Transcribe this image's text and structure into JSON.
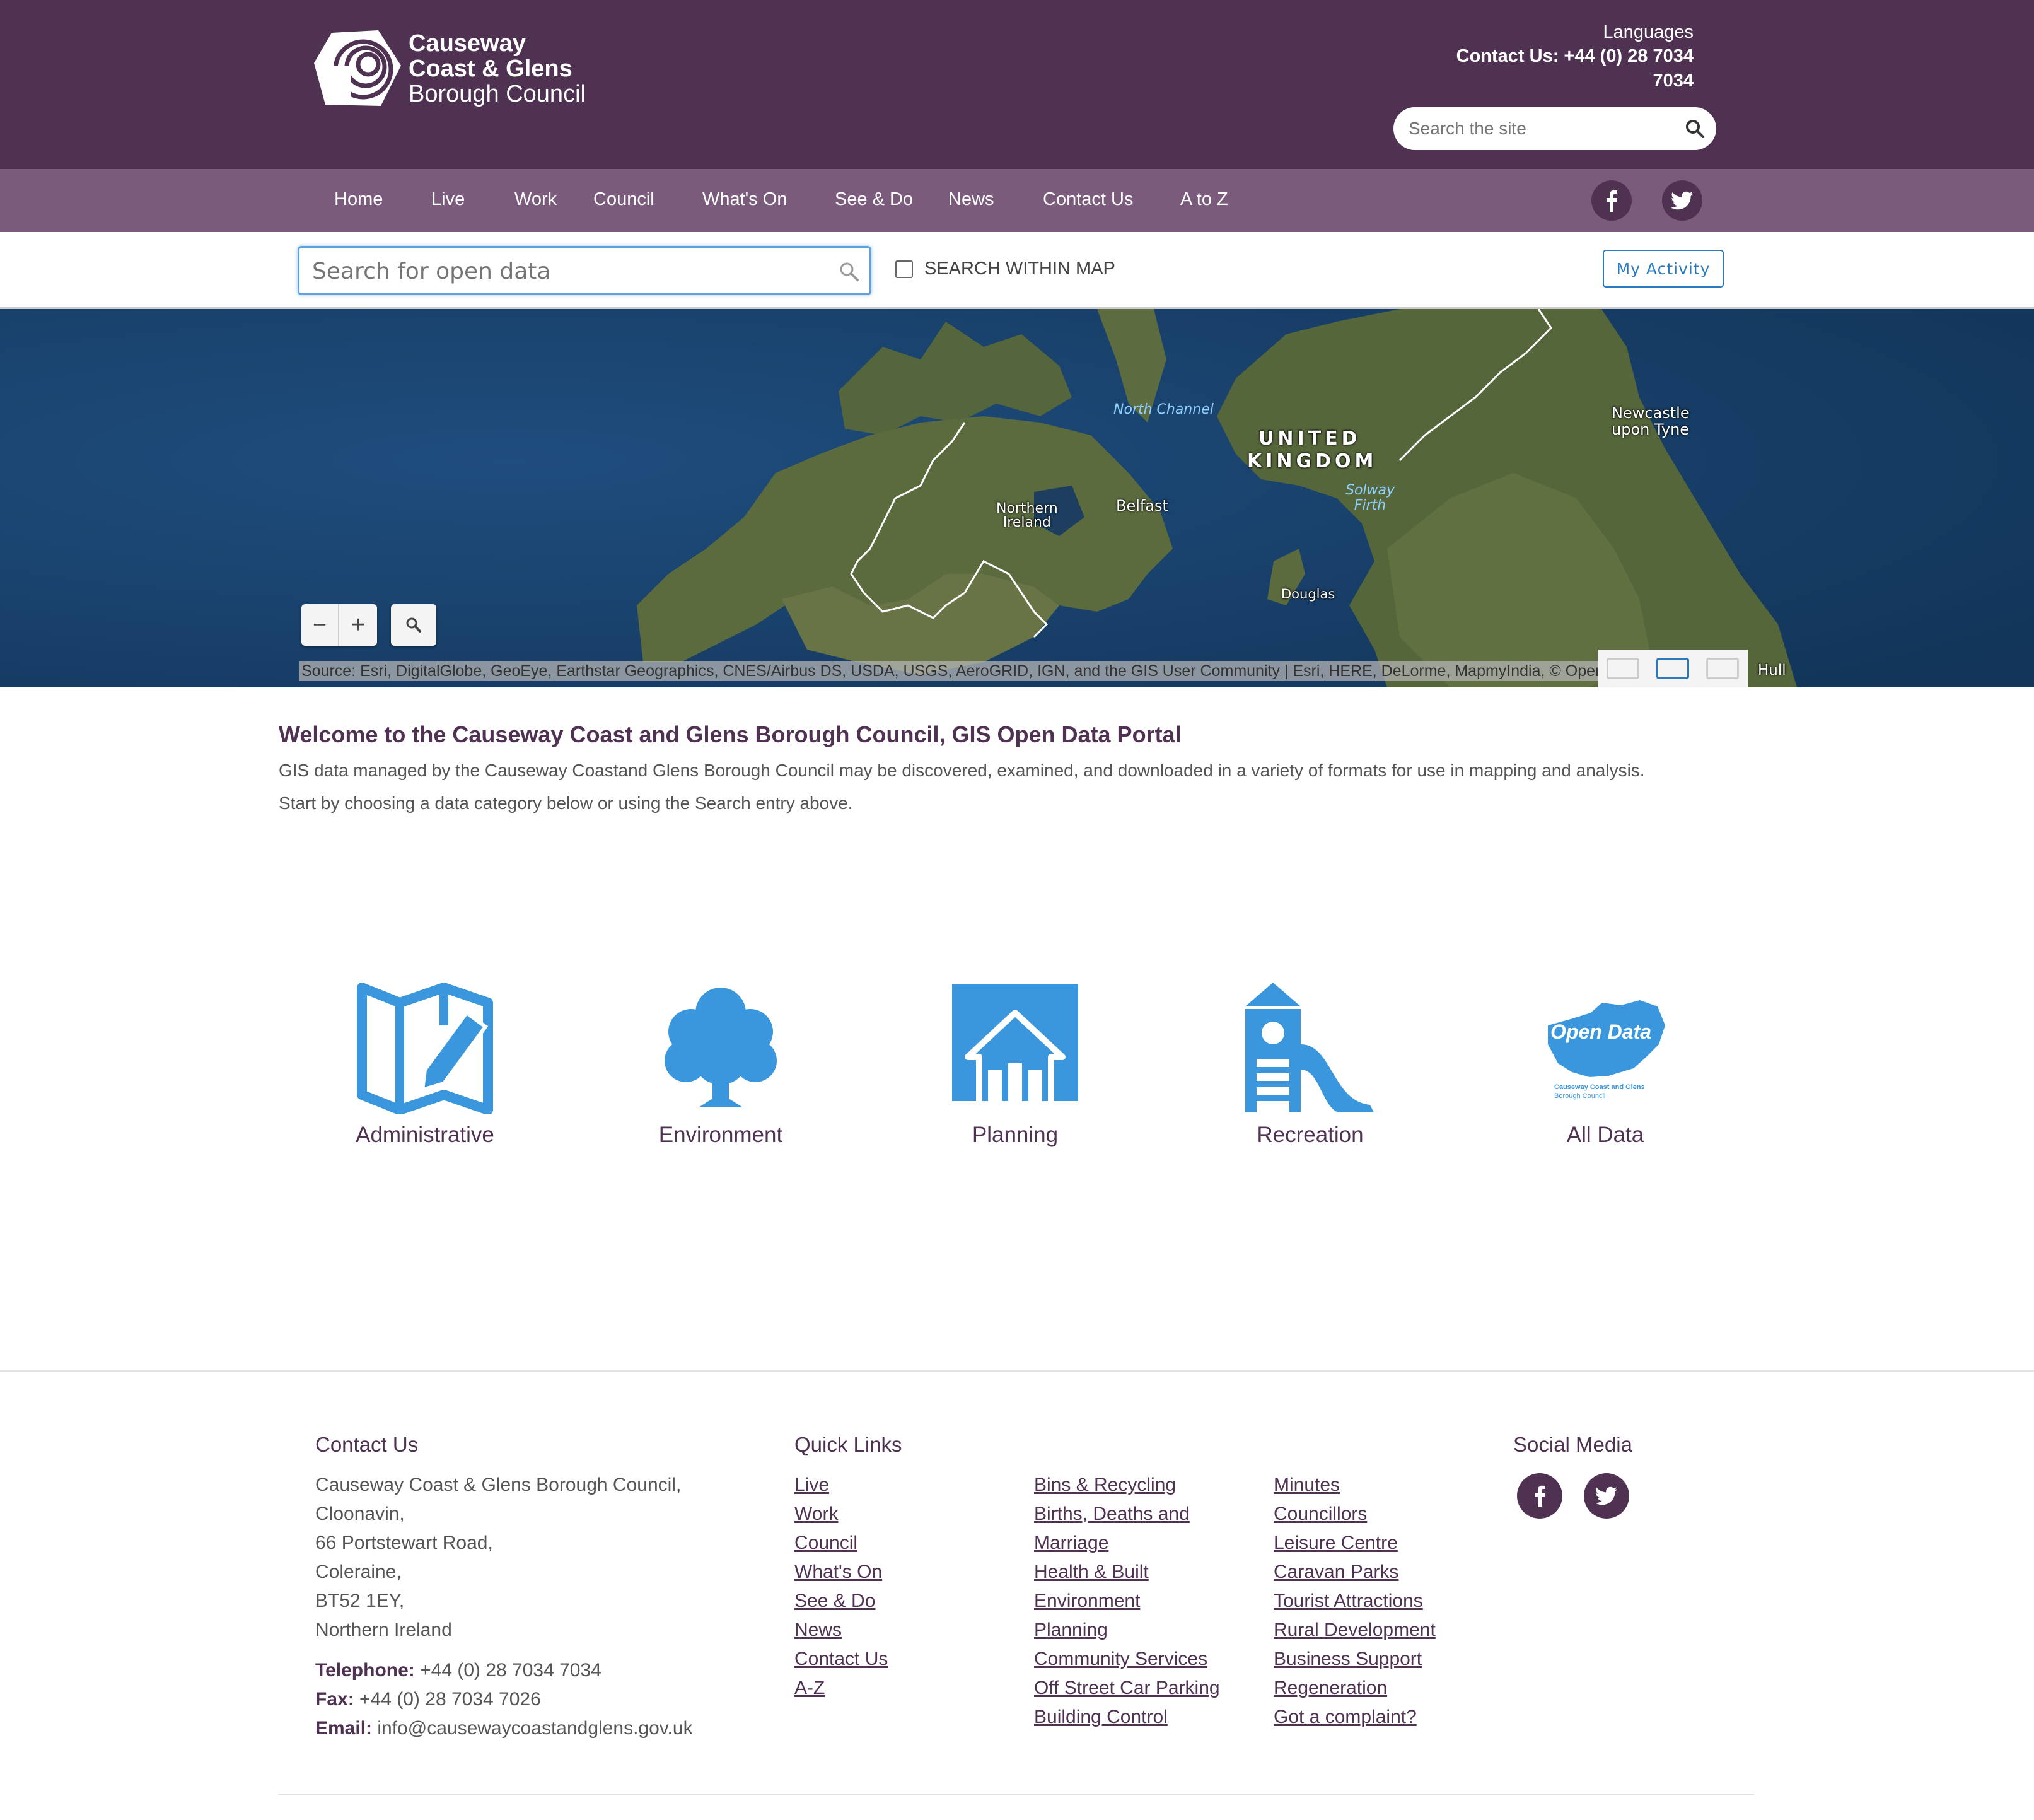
{
  "header": {
    "logo": {
      "line1": "Causeway",
      "line2": "Coast & Glens",
      "line3": "Borough Council"
    },
    "languages": "Languages",
    "contact": "Contact Us: +44 (0) 28 7034 7034",
    "search_placeholder": "Search the site"
  },
  "nav": {
    "items": [
      "Home",
      "Live",
      "Work",
      "Council",
      "What's On",
      "See & Do",
      "News",
      "Contact Us",
      "A to Z"
    ]
  },
  "data_search": {
    "placeholder": "Search for open data",
    "within_map_label": "SEARCH WITHIN MAP",
    "my_activity_label": "My Activity"
  },
  "map": {
    "labels": {
      "north_channel": "North Channel",
      "united_kingdom_1": "UNITED",
      "united_kingdom_2": "KINGDOM",
      "newcastle_1": "Newcastle",
      "newcastle_2": "upon Tyne",
      "northern_ireland_1": "Northern",
      "northern_ireland_2": "Ireland",
      "belfast": "Belfast",
      "solway_1": "Solway",
      "solway_2": "Firth",
      "douglas": "Douglas",
      "hull": "Hull"
    },
    "zoom_out": "−",
    "zoom_in": "+",
    "attribution": "Source: Esri, DigitalGlobe, GeoEye, Earthstar Geographics, CNES/Airbus DS, USDA, USGS, AeroGRID, IGN, and the GIS User Community |  Esri, HERE, DeLorme, MapmyIndia, © OpenStreetMap contributors"
  },
  "welcome": {
    "title": "Welcome to the Causeway Coast and Glens Borough Council, GIS Open Data Portal",
    "line1": "GIS data managed by the Causeway Coastand Glens Borough Council may be discovered, examined, and downloaded in a variety of formats for use in mapping and analysis.",
    "line2": "Start by choosing a data category below or using the Search entry above."
  },
  "categories": [
    {
      "label": "Administrative",
      "icon": "map-pencil-icon"
    },
    {
      "label": "Environment",
      "icon": "tree-icon"
    },
    {
      "label": "Planning",
      "icon": "house-icon"
    },
    {
      "label": "Recreation",
      "icon": "slide-icon"
    },
    {
      "label": "All Data",
      "icon": "open-data-map-icon",
      "icon_text": "Open Data",
      "icon_subtext_1": "Causeway Coast and Glens",
      "icon_subtext_2": "Borough Council"
    }
  ],
  "footer": {
    "contact_title": "Contact Us",
    "address": [
      "Causeway Coast & Glens Borough Council,",
      "Cloonavin,",
      "66 Portstewart Road,",
      "Coleraine,",
      "BT52 1EY,",
      "Northern Ireland"
    ],
    "telephone_label": "Telephone:",
    "telephone": "+44 (0) 28 7034 7034",
    "fax_label": "Fax:",
    "fax": "+44 (0) 28 7034 7026",
    "email_label": "Email:",
    "email": "info@causewaycoastandglens.gov.uk",
    "quick_links_title": "Quick Links",
    "links_col1": [
      "Live",
      "Work",
      "Council",
      "What's On",
      "See & Do",
      "News",
      "Contact Us",
      "A-Z"
    ],
    "links_col2": [
      "Bins & Recycling",
      "Births, Deaths and",
      "Marriage",
      "Health & Built",
      "Environment",
      "Planning",
      "Community Services",
      "Off Street Car Parking",
      "Building Control"
    ],
    "links_col3": [
      "Minutes",
      "Councillors",
      "Leisure Centre",
      "Caravan Parks",
      "Tourist Attractions",
      "Rural Development",
      "Business Support",
      "Regeneration",
      "Got a complaint?"
    ],
    "social_title": "Social Media"
  },
  "colors": {
    "brand_purple": "#4f3252",
    "nav_purple": "#7b5b7c",
    "icon_blue": "#3a96dd",
    "link_blue": "#2a7ac0"
  }
}
